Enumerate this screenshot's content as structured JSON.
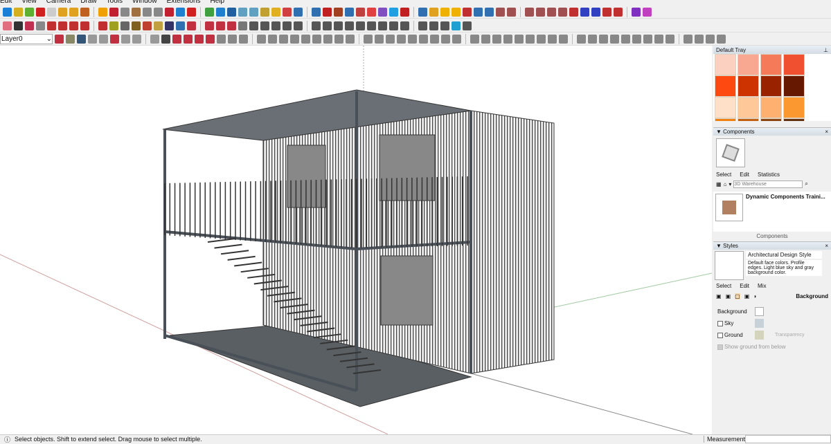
{
  "menu": [
    "Edit",
    "View",
    "Camera",
    "Draw",
    "Tools",
    "Window",
    "Extensions",
    "Help"
  ],
  "toolbar": {
    "layer_value": "Layer0",
    "row1_colors": [
      "#1a7fd6",
      "#d4b020",
      "#5fb030",
      "#d02020",
      "#ccc",
      "#e0a020",
      "#e0a020",
      "#c06020",
      "#f0a000",
      "#c02030",
      "#888",
      "#a07040",
      "#888",
      "#888",
      "#c02030",
      "#2080d0",
      "#d02020",
      "#40a040",
      "#2080d0",
      "#2060a0",
      "#60a0c0",
      "#60a0c0",
      "#c0a030",
      "#e0b020",
      "#d04040",
      "#3070b0",
      "#3070b0",
      "#c02020",
      "#a04020",
      "#3070b0",
      "#c04040",
      "#e04040",
      "#8050c0",
      "#20a0e0",
      "#c02020",
      "#3070b0",
      "#e0a020",
      "#f0b000",
      "#f0b000",
      "#c03030",
      "#3070b0",
      "#3070b0",
      "#a05050",
      "#a05050",
      "#a05050",
      "#a05050",
      "#a05050",
      "#a05050",
      "#c03030",
      "#3040c0",
      "#3040c0",
      "#c03030",
      "#c03030",
      "#8030c0",
      "#c040c0"
    ],
    "row2_colors": [
      "#e07080",
      "#333",
      "#c03050",
      "#888",
      "#c03030",
      "#c03030",
      "#c03030",
      "#c03030",
      "#c03030",
      "#a0a020",
      "#666",
      "#806020",
      "#c04030",
      "#c0a040",
      "#336",
      "#3070b0",
      "#c03040",
      "#c03040",
      "#c03040",
      "#c03040",
      "#777",
      "#555",
      "#555",
      "#555",
      "#555",
      "#555",
      "#555",
      "#555",
      "#555",
      "#555",
      "#555",
      "#555",
      "#555",
      "#555",
      "#555",
      "#555",
      "#555",
      "#555",
      "#20a0d0",
      "#555"
    ],
    "row3_colors": [
      "#c03040",
      "#886",
      "#357",
      "#999",
      "#999",
      "#c03040",
      "#999",
      "#999",
      "#999",
      "#444",
      "#c03040",
      "#c03040",
      "#c03040",
      "#c03040",
      "#888",
      "#888",
      "#888",
      "#888",
      "#888",
      "#888",
      "#888",
      "#888",
      "#888",
      "#888",
      "#888",
      "#888",
      "#888",
      "#888",
      "#888",
      "#888",
      "#888",
      "#888",
      "#888",
      "#888",
      "#888",
      "#888",
      "#888",
      "#888",
      "#888",
      "#888",
      "#888",
      "#888",
      "#888",
      "#888",
      "#888",
      "#888",
      "#888",
      "#888",
      "#888",
      "#888",
      "#888",
      "#888",
      "#888",
      "#888",
      "#888",
      "#888",
      "#888"
    ]
  },
  "tray": {
    "title": "Default Tray",
    "swatches": [
      "#fbd0c0",
      "#f8a890",
      "#f57a5a",
      "#f05030",
      "#fe4a10",
      "#cc3300",
      "#992200",
      "#661800",
      "#fee0c8",
      "#fec898",
      "#fdb070",
      "#fc9830",
      "#f08010",
      "#c06010",
      "#8a4510",
      "#603010"
    ]
  },
  "components": {
    "title": "Components",
    "tabs": [
      "Select",
      "Edit",
      "Statistics"
    ],
    "search_placeholder": "3D Warehouse",
    "item_title": "Dynamic Components Traini...",
    "footer": "Components"
  },
  "styles": {
    "title": "Styles",
    "style_name": "Architectural Design Style",
    "style_desc": "Default face colors. Profile edges. Light blue sky and gray background color.",
    "tabs": [
      "Select",
      "Edit",
      "Mix"
    ],
    "section": "Background",
    "background_label": "Background",
    "sky_label": "Sky",
    "ground_label": "Ground",
    "transparency_label": "Transparency",
    "show_ground_label": "Show ground from below",
    "background_color": "#ffffff",
    "sky_color": "#c8d0d8",
    "ground_color": "#d4d4bc"
  },
  "status": {
    "message": "Select objects. Shift to extend select. Drag mouse to select multiple.",
    "measurements_label": "Measurements"
  }
}
